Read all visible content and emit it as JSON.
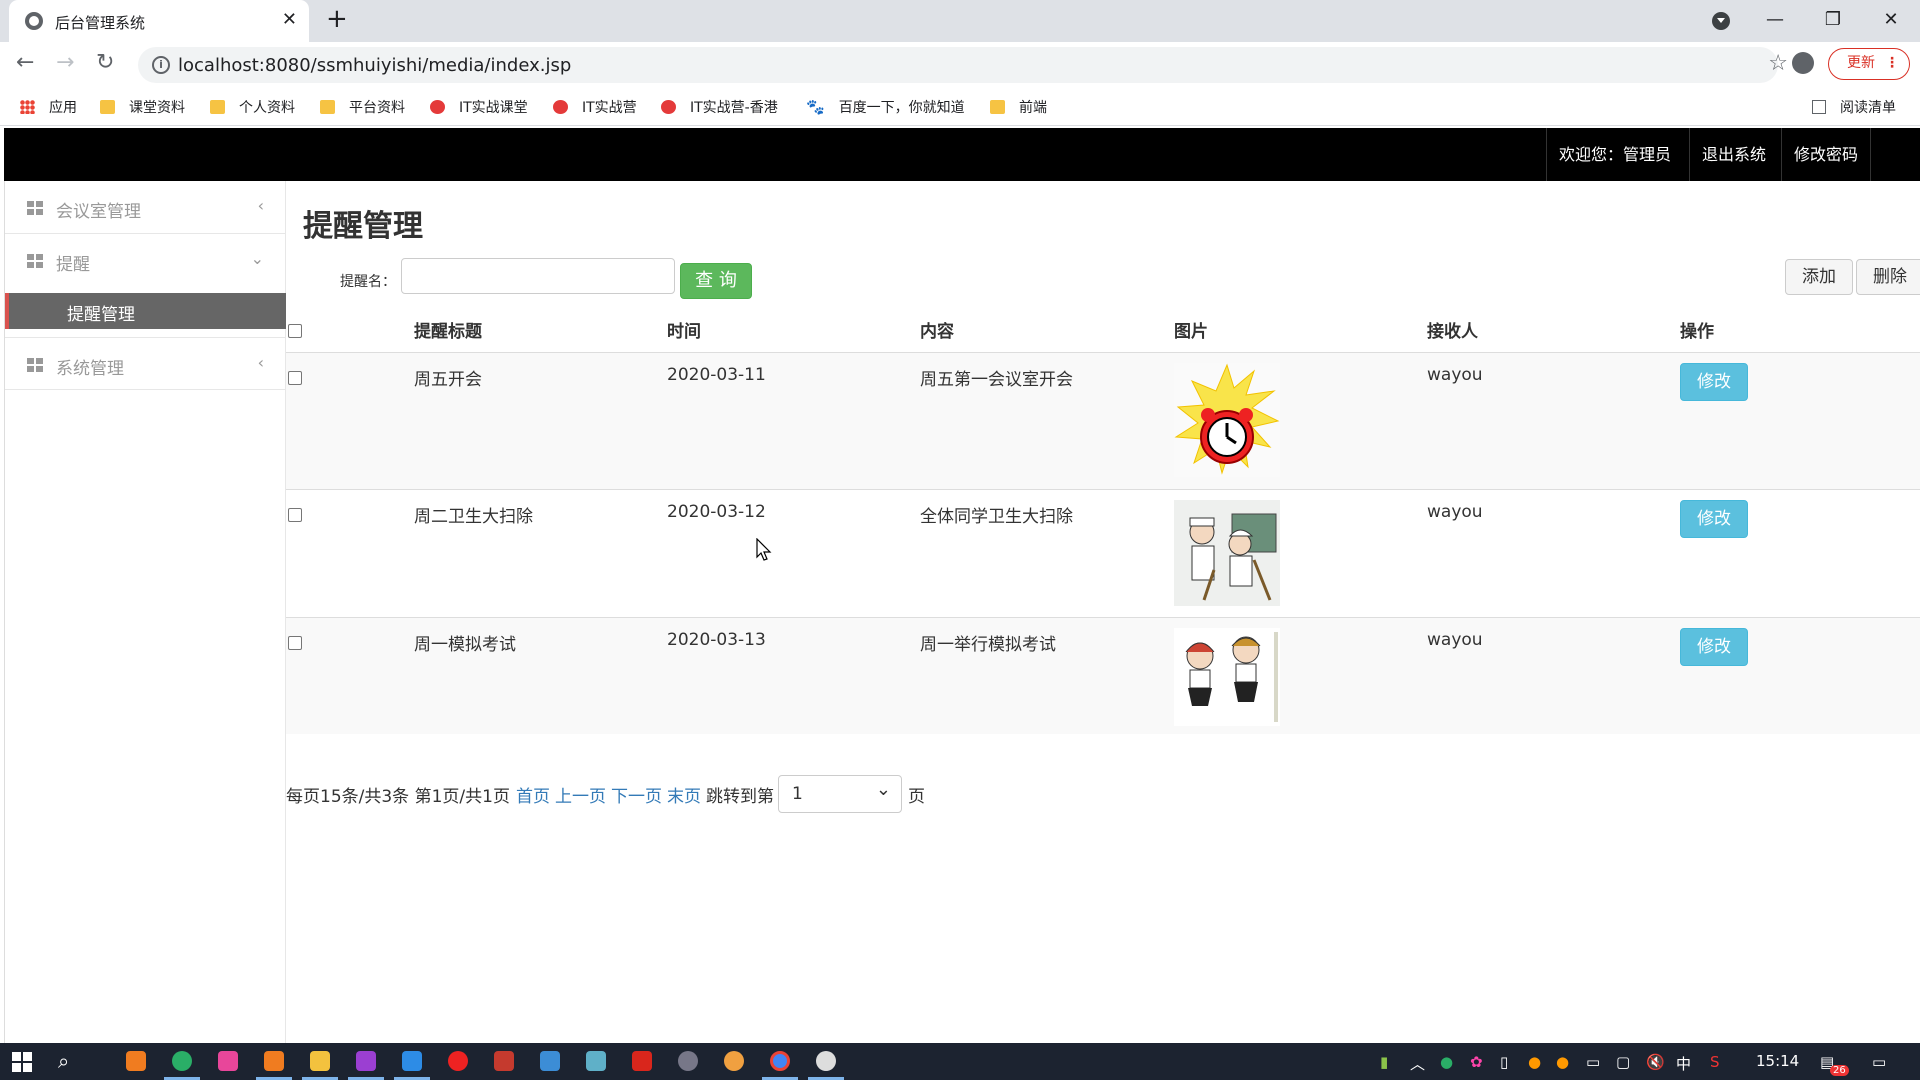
{
  "browser": {
    "tab_title": "后台管理系统",
    "url": "localhost:8080/ssmhuiyishi/media/index.jsp",
    "update_label": "更新",
    "bookmarks": [
      "应用",
      "课堂资料",
      "个人资料",
      "平台资料",
      "IT实战课堂",
      "IT实战营",
      "IT实战营-香港",
      "百度一下，你就知道",
      "前端"
    ],
    "reading_list": "阅读清单"
  },
  "header": {
    "welcome": "欢迎您：管理员",
    "logout": "退出系统",
    "change_password": "修改密码"
  },
  "sidebar": {
    "items": [
      {
        "label": "会议室管理"
      },
      {
        "label": "提醒"
      },
      {
        "label": "系统管理"
      }
    ],
    "sub_active": "提醒管理"
  },
  "main": {
    "title": "提醒管理",
    "search_label": "提醒名：",
    "search_value": "",
    "search_button": "查 询",
    "add_button": "添加",
    "delete_button": "删除",
    "columns": [
      "提醒标题",
      "时间",
      "内容",
      "图片",
      "接收人",
      "操作"
    ],
    "rows": [
      {
        "title": "周五开会",
        "time": "2020-03-11",
        "content": "周五第一会议室开会",
        "receiver": "wayou",
        "action": "修改",
        "image": "alarm-clock"
      },
      {
        "title": "周二卫生大扫除",
        "time": "2020-03-12",
        "content": "全体同学卫生大扫除",
        "receiver": "wayou",
        "action": "修改",
        "image": "cleaning-cartoon"
      },
      {
        "title": "周一模拟考试",
        "time": "2020-03-13",
        "content": "周一举行模拟考试",
        "receiver": "wayou",
        "action": "修改",
        "image": "students-cartoon"
      }
    ],
    "pager": {
      "summary": "每页15条/共3条 第1页/共1页",
      "first": "首页",
      "prev": "上一页",
      "next": "下一页",
      "last": "末页",
      "jump_label": "跳转到第",
      "jump_value": "1",
      "page_suffix": "页"
    }
  },
  "taskbar": {
    "time": "15:14",
    "ime": "中",
    "badge": "26"
  }
}
